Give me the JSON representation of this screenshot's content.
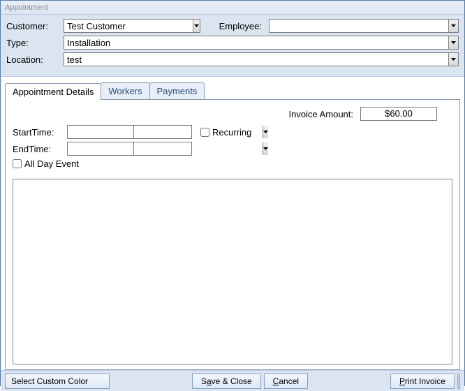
{
  "title": "Appointment",
  "header": {
    "customer_label": "Customer:",
    "customer_value": "Test Customer",
    "employee_label": "Employee:",
    "employee_value": "",
    "type_label": "Type:",
    "type_value": "Installation",
    "location_label": "Location:",
    "location_value": "test"
  },
  "tabs": [
    {
      "label": "Appointment Details",
      "active": true
    },
    {
      "label": "Workers",
      "active": false
    },
    {
      "label": "Payments",
      "active": false
    }
  ],
  "details": {
    "invoice_label": "Invoice Amount:",
    "invoice_value": "$60.00",
    "starttime_label": "StartTime:",
    "starttime_date": "",
    "starttime_time": "",
    "endtime_label": "EndTime:",
    "endtime_date": "",
    "endtime_time": "",
    "recurring_label": "Recurring",
    "recurring_checked": false,
    "allday_label": "All Day Event",
    "allday_checked": false,
    "notes": ""
  },
  "footer": {
    "select_color": "Select Custom Color",
    "save_close_pre": "S",
    "save_close_u": "a",
    "save_close_post": "ve & Close",
    "cancel_u": "C",
    "cancel_post": "ancel",
    "print_u": "P",
    "print_post": "rint Invoice"
  }
}
